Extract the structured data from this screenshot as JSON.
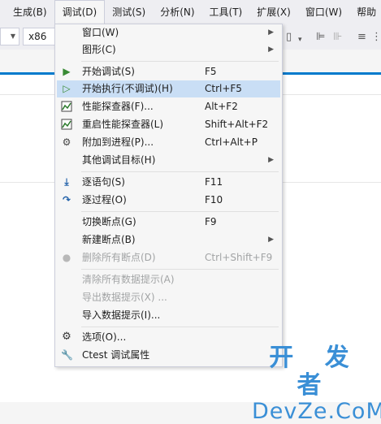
{
  "menubar": {
    "items": [
      "生成(B)",
      "调试(D)",
      "测试(S)",
      "分析(N)",
      "工具(T)",
      "扩展(X)",
      "窗口(W)",
      "帮助"
    ]
  },
  "toolbar": {
    "platform": "x86"
  },
  "debug_menu": {
    "items": [
      {
        "label": "窗口(W)",
        "shortcut": "",
        "submenu": true,
        "enabled": true,
        "icon": ""
      },
      {
        "label": "图形(C)",
        "shortcut": "",
        "submenu": true,
        "enabled": true,
        "icon": ""
      },
      {
        "label": "开始调试(S)",
        "shortcut": "F5",
        "submenu": false,
        "enabled": true,
        "icon": "play-filled-icon"
      },
      {
        "label": "开始执行(不调试)(H)",
        "shortcut": "Ctrl+F5",
        "submenu": false,
        "enabled": true,
        "icon": "play-outline-icon"
      },
      {
        "label": "性能探查器(F)...",
        "shortcut": "Alt+F2",
        "submenu": false,
        "enabled": true,
        "icon": "performance-icon"
      },
      {
        "label": "重启性能探查器(L)",
        "shortcut": "Shift+Alt+F2",
        "submenu": false,
        "enabled": true,
        "icon": "performance-icon"
      },
      {
        "label": "附加到进程(P)...",
        "shortcut": "Ctrl+Alt+P",
        "submenu": false,
        "enabled": true,
        "icon": "attach-process-icon"
      },
      {
        "label": "其他调试目标(H)",
        "shortcut": "",
        "submenu": true,
        "enabled": true,
        "icon": ""
      },
      {
        "label": "逐语句(S)",
        "shortcut": "F11",
        "submenu": false,
        "enabled": true,
        "icon": "step-into-icon"
      },
      {
        "label": "逐过程(O)",
        "shortcut": "F10",
        "submenu": false,
        "enabled": true,
        "icon": "step-over-icon"
      },
      {
        "label": "切换断点(G)",
        "shortcut": "F9",
        "submenu": false,
        "enabled": true,
        "icon": ""
      },
      {
        "label": "新建断点(B)",
        "shortcut": "",
        "submenu": true,
        "enabled": true,
        "icon": ""
      },
      {
        "label": "删除所有断点(D)",
        "shortcut": "Ctrl+Shift+F9",
        "submenu": false,
        "enabled": false,
        "icon": "delete-breakpoints-icon"
      },
      {
        "label": "清除所有数据提示(A)",
        "shortcut": "",
        "submenu": false,
        "enabled": false,
        "icon": ""
      },
      {
        "label": "导出数据提示(X) ...",
        "shortcut": "",
        "submenu": false,
        "enabled": false,
        "icon": ""
      },
      {
        "label": "导入数据提示(I)...",
        "shortcut": "",
        "submenu": false,
        "enabled": true,
        "icon": ""
      },
      {
        "label": "选项(O)...",
        "shortcut": "",
        "submenu": false,
        "enabled": true,
        "icon": "gear-icon"
      },
      {
        "label": "Ctest 调试属性",
        "shortcut": "",
        "submenu": false,
        "enabled": true,
        "icon": "wrench-icon"
      }
    ],
    "highlighted_index": 3
  },
  "watermark": {
    "line1": "开 发 者",
    "line2": "DevZe.CoM"
  },
  "colors": {
    "accent": "#007acc",
    "highlight": "#c9def5",
    "play_green": "#388a34",
    "disabled_text": "#a2a4a5",
    "watermark": "#3a8fd6"
  }
}
